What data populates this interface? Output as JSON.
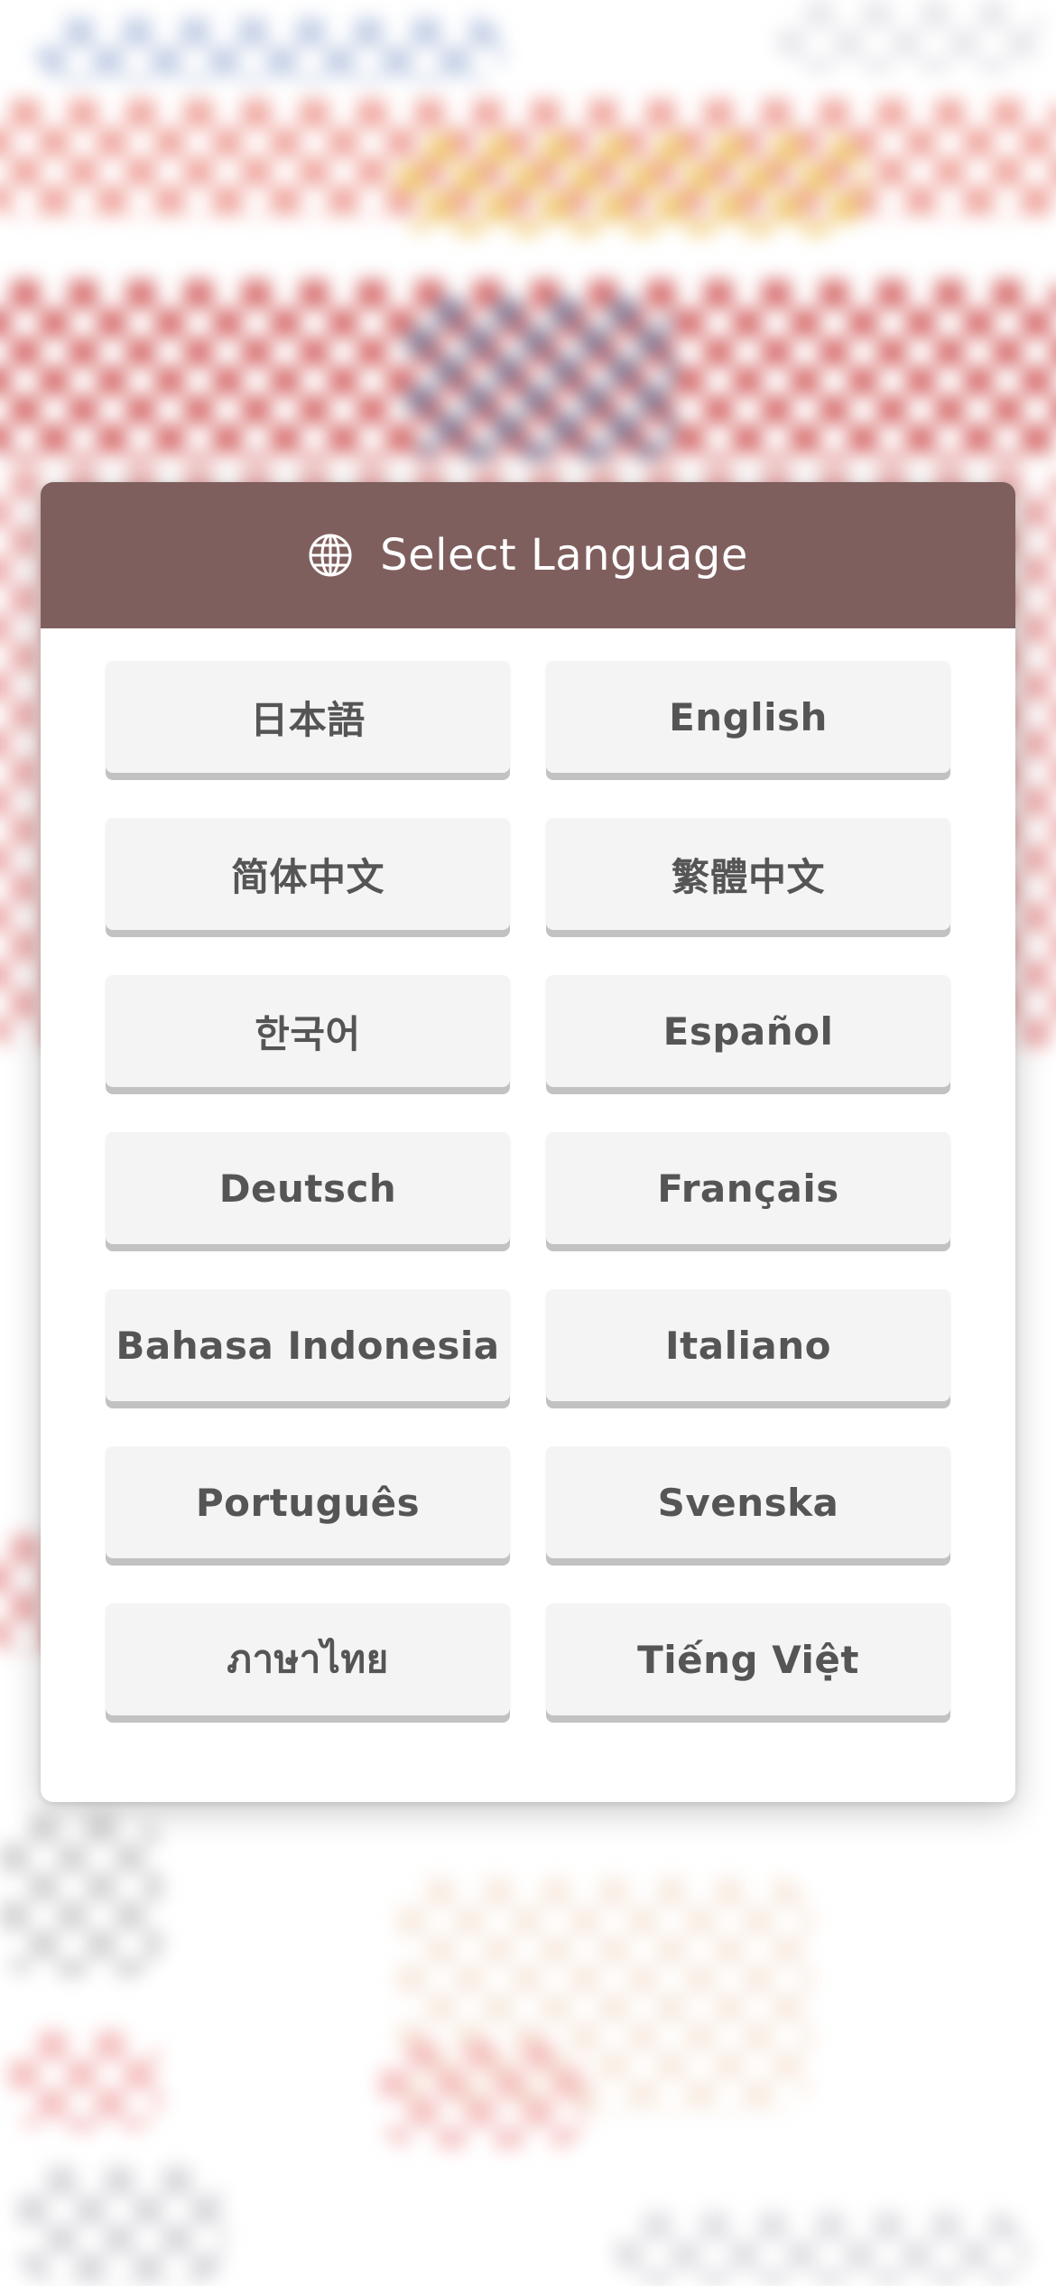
{
  "modal": {
    "title": "Select Language",
    "header_icon": "globe-icon",
    "header_color": "#7f5f5e"
  },
  "languages": [
    {
      "key": "ja",
      "label": "日本語"
    },
    {
      "key": "en",
      "label": "English"
    },
    {
      "key": "zh-hans",
      "label": "简体中文"
    },
    {
      "key": "zh-hant",
      "label": "繁體中文"
    },
    {
      "key": "ko",
      "label": "한국어"
    },
    {
      "key": "es",
      "label": "Español"
    },
    {
      "key": "de",
      "label": "Deutsch"
    },
    {
      "key": "fr",
      "label": "Français"
    },
    {
      "key": "id",
      "label": "Bahasa Indonesia"
    },
    {
      "key": "it",
      "label": "Italiano"
    },
    {
      "key": "pt",
      "label": "Português"
    },
    {
      "key": "sv",
      "label": "Svenska"
    },
    {
      "key": "th",
      "label": "ภาษาไทย"
    },
    {
      "key": "vi",
      "label": "Tiếng Việt"
    }
  ]
}
